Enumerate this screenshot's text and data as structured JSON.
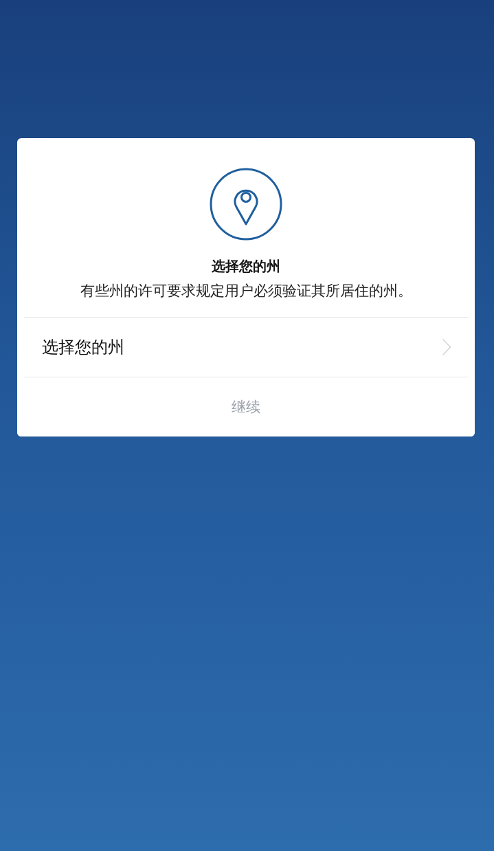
{
  "dialog": {
    "title": "选择您的州",
    "description": "有些州的许可要求规定用户必须验证其所居住的州。",
    "state_selector": {
      "label": "选择您的州"
    },
    "continue_button": {
      "label": "继续",
      "disabled": true
    }
  }
}
